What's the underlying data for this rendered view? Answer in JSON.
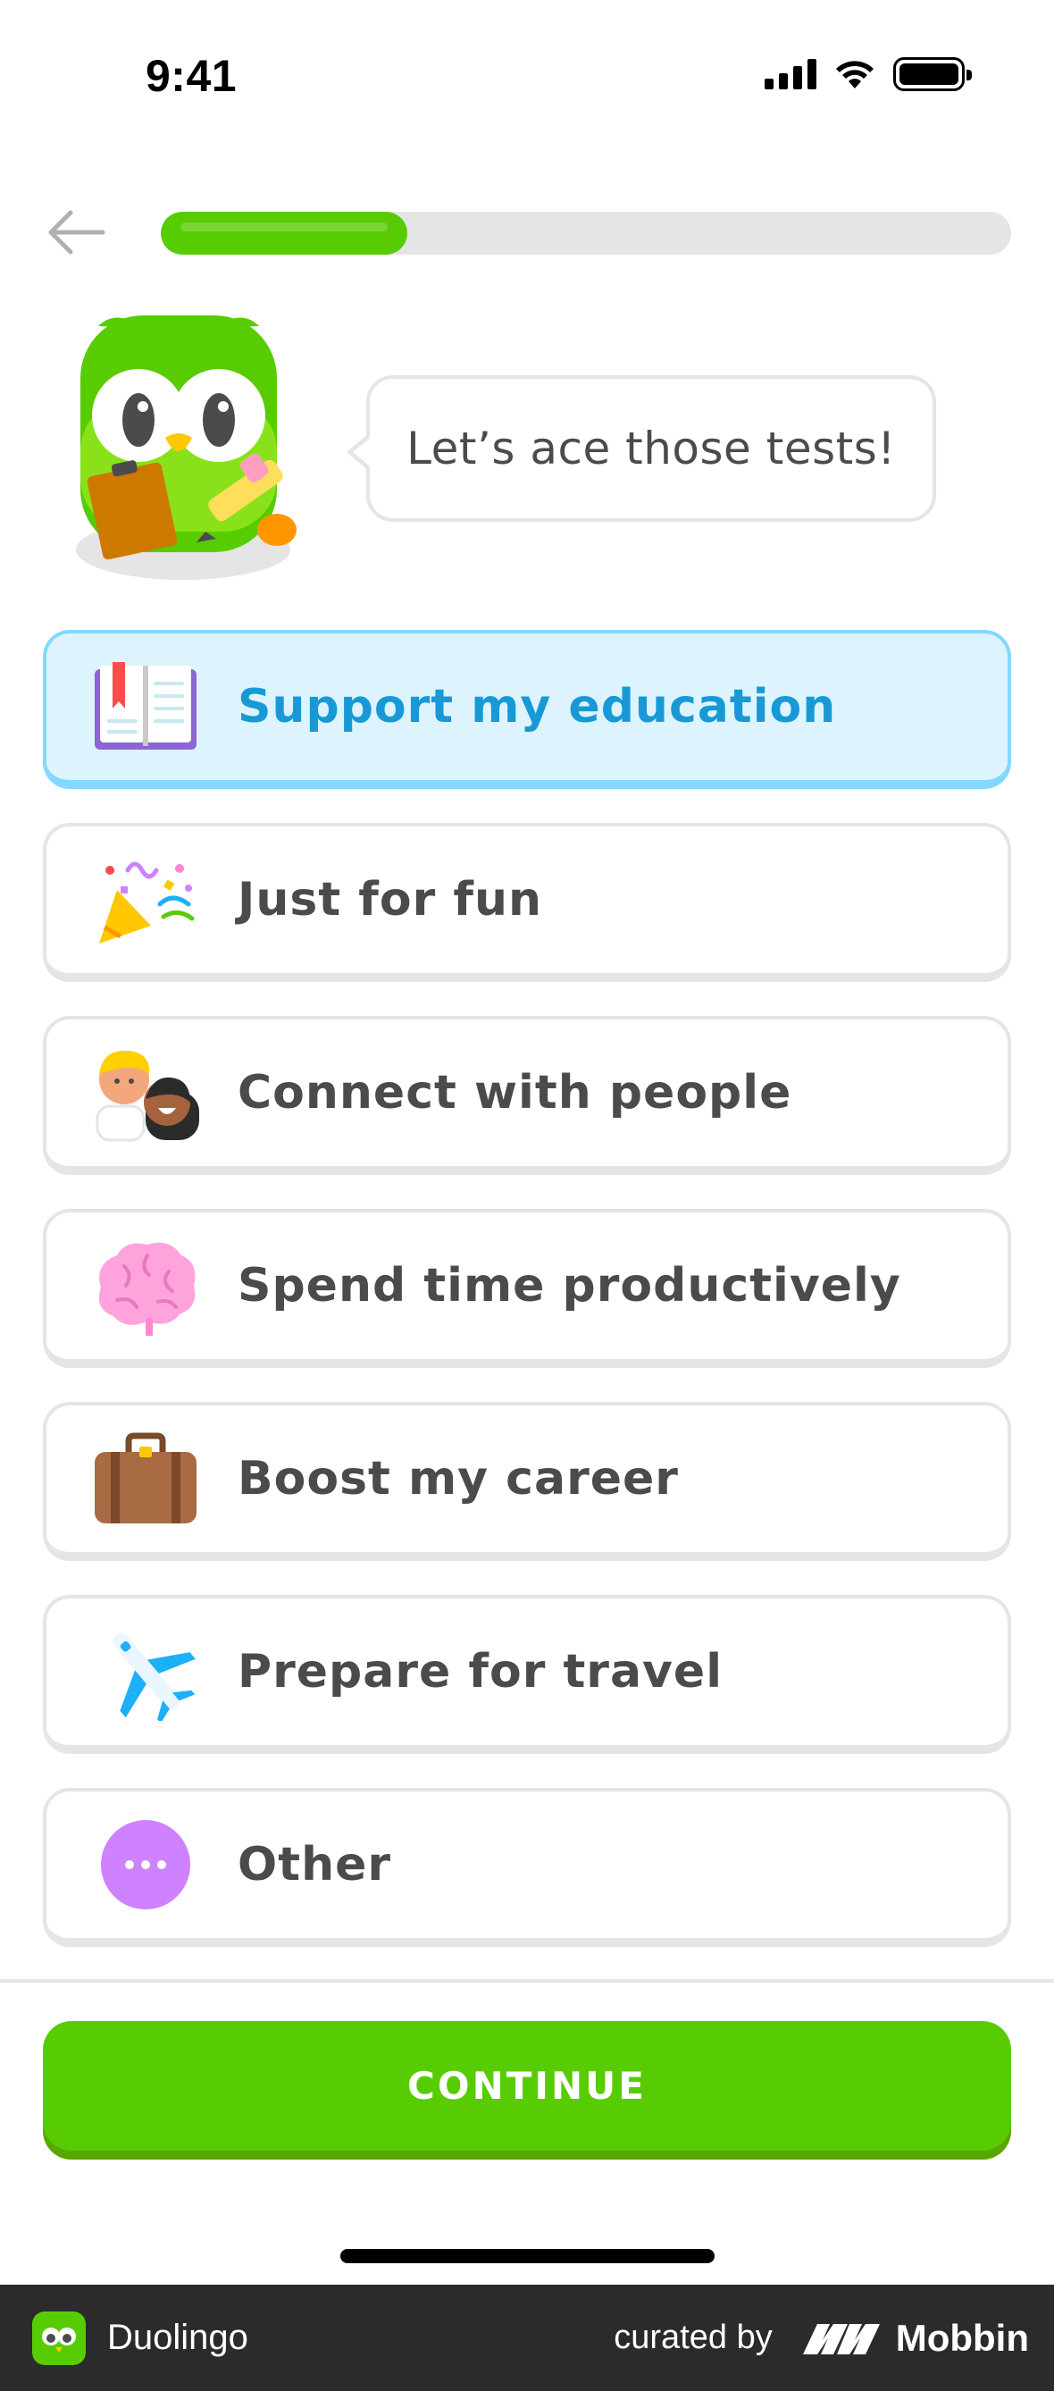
{
  "status_bar": {
    "time": "9:41"
  },
  "header": {
    "progress_value": 0.29
  },
  "mascot": {
    "speech": "Let’s ace those tests!"
  },
  "options": [
    {
      "label": "Support my education",
      "icon": "open-book-icon",
      "selected": true
    },
    {
      "label": "Just for fun",
      "icon": "party-popper-icon",
      "selected": false
    },
    {
      "label": "Connect with people",
      "icon": "people-icon",
      "selected": false
    },
    {
      "label": "Spend time productively",
      "icon": "brain-icon",
      "selected": false
    },
    {
      "label": "Boost my career",
      "icon": "briefcase-icon",
      "selected": false
    },
    {
      "label": "Prepare for travel",
      "icon": "airplane-icon",
      "selected": false
    },
    {
      "label": "Other",
      "icon": "more-dots-icon",
      "selected": false
    }
  ],
  "footer": {
    "continue_label": "CONTINUE"
  },
  "watermark": {
    "app_name": "Duolingo",
    "curated_by": "curated by",
    "source": "Mobbin"
  },
  "colors": {
    "brand_green": "#58cc02",
    "selected_bg": "#ddf4ff",
    "selected_border": "#84d8ff",
    "selected_text": "#1899d6",
    "text": "#4b4b4b",
    "border": "#e5e5e5"
  }
}
